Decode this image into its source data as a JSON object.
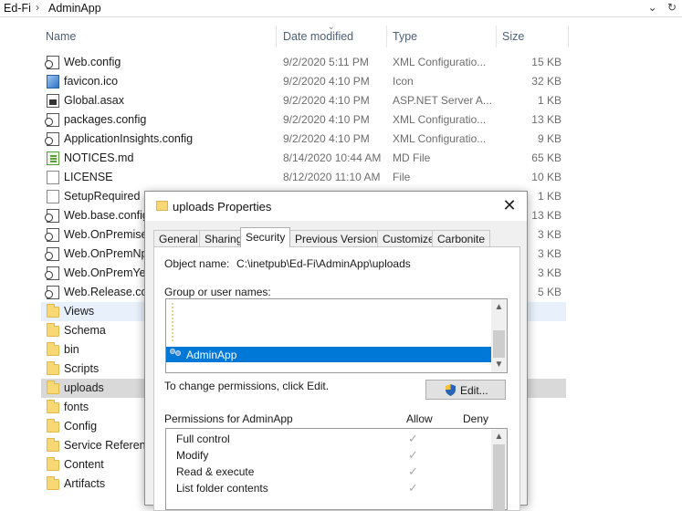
{
  "address": {
    "crumbs": [
      "Ed-Fi",
      "AdminApp"
    ],
    "separator": "›",
    "dropdown_glyph": "⌄",
    "refresh_glyph": "↻"
  },
  "columns": {
    "name": "Name",
    "date": "Date modified",
    "type": "Type",
    "size": "Size"
  },
  "files": [
    {
      "name": "Web.config",
      "date": "9/2/2020 5:11 PM",
      "type": "XML Configuratio...",
      "size": "15 KB",
      "icon": "config-icon"
    },
    {
      "name": "favicon.ico",
      "date": "9/2/2020 4:10 PM",
      "type": "Icon",
      "size": "32 KB",
      "icon": "image-icon"
    },
    {
      "name": "Global.asax",
      "date": "9/2/2020 4:10 PM",
      "type": "ASP.NET Server A...",
      "size": "1 KB",
      "icon": "asax-icon"
    },
    {
      "name": "packages.config",
      "date": "9/2/2020 4:10 PM",
      "type": "XML Configuratio...",
      "size": "13 KB",
      "icon": "config-icon"
    },
    {
      "name": "ApplicationInsights.config",
      "date": "9/2/2020 4:10 PM",
      "type": "XML Configuratio...",
      "size": "9 KB",
      "icon": "config-icon"
    },
    {
      "name": "NOTICES.md",
      "date": "8/14/2020 10:44 AM",
      "type": "MD File",
      "size": "65 KB",
      "icon": "markdown-icon"
    },
    {
      "name": "LICENSE",
      "date": "8/12/2020 11:10 AM",
      "type": "File",
      "size": "10 KB",
      "icon": "file-icon"
    },
    {
      "name": "SetupRequired",
      "date": "",
      "type": "",
      "size": "1 KB",
      "icon": "file-icon"
    },
    {
      "name": "Web.base.config",
      "date": "",
      "type": "",
      "size": "13 KB",
      "icon": "config-icon"
    },
    {
      "name": "Web.OnPremises",
      "date": "",
      "type": "",
      "size": "3 KB",
      "icon": "config-icon"
    },
    {
      "name": "Web.OnPremNp",
      "date": "",
      "type": "",
      "size": "3 KB",
      "icon": "config-icon"
    },
    {
      "name": "Web.OnPremYea",
      "date": "",
      "type": "",
      "size": "3 KB",
      "icon": "config-icon"
    },
    {
      "name": "Web.Release.con",
      "date": "",
      "type": "",
      "size": "5 KB",
      "icon": "config-icon"
    },
    {
      "name": "Views",
      "date": "",
      "type": "",
      "size": "",
      "icon": "folder-icon"
    },
    {
      "name": "Schema",
      "date": "",
      "type": "",
      "size": "",
      "icon": "folder-icon"
    },
    {
      "name": "bin",
      "date": "",
      "type": "",
      "size": "",
      "icon": "folder-icon"
    },
    {
      "name": "Scripts",
      "date": "",
      "type": "",
      "size": "",
      "icon": "folder-icon"
    },
    {
      "name": "uploads",
      "date": "",
      "type": "",
      "size": "",
      "icon": "folder-icon"
    },
    {
      "name": "fonts",
      "date": "",
      "type": "",
      "size": "",
      "icon": "folder-icon"
    },
    {
      "name": "Config",
      "date": "",
      "type": "",
      "size": "",
      "icon": "folder-icon"
    },
    {
      "name": "Service Reference",
      "date": "",
      "type": "",
      "size": "",
      "icon": "folder-icon"
    },
    {
      "name": "Content",
      "date": "",
      "type": "",
      "size": "",
      "icon": "folder-icon"
    },
    {
      "name": "Artifacts",
      "date": "",
      "type": "",
      "size": "",
      "icon": "folder-icon"
    }
  ],
  "dialog": {
    "title": "uploads Properties",
    "close_glyph": "✕",
    "tabs": [
      "General",
      "Sharing",
      "Security",
      "Previous Versions",
      "Customize",
      "Carbonite"
    ],
    "active_tab": "Security",
    "object_name_label": "Object name:",
    "object_name_value": "C:\\inetpub\\Ed-Fi\\AdminApp\\uploads",
    "group_label": "Group or user names:",
    "selected_user": "AdminApp",
    "change_hint": "To change permissions, click Edit.",
    "edit_button": "Edit...",
    "permissions_label": "Permissions for AdminApp",
    "allow_header": "Allow",
    "deny_header": "Deny",
    "permissions": [
      {
        "name": "Full control",
        "allow": true
      },
      {
        "name": "Modify",
        "allow": true
      },
      {
        "name": "Read & execute",
        "allow": true
      },
      {
        "name": "List folder contents",
        "allow": true
      }
    ],
    "check_glyph": "✓",
    "scroll_up_glyph": "▲",
    "scroll_down_glyph": "▼",
    "colors": {
      "selection": "#0078d7",
      "folder": "#f8d775"
    }
  }
}
